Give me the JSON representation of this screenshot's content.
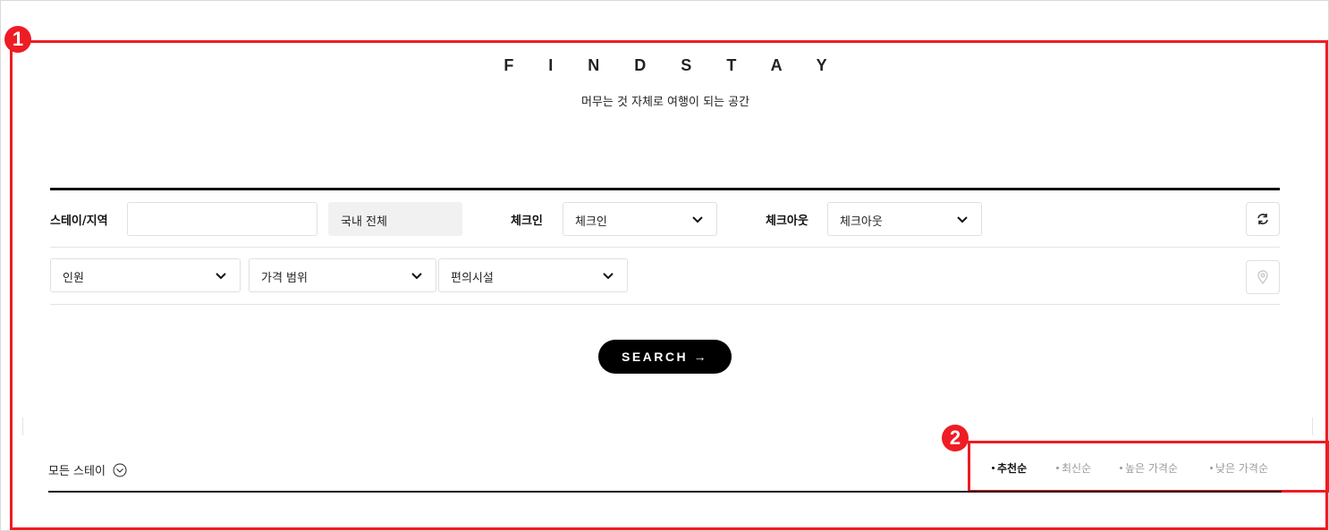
{
  "header": {
    "title": "F I N D  S T A Y",
    "subtitle": "머무는 것 자체로 여행이 되는 공간"
  },
  "search_form": {
    "stay_region_label": "스테이/지역",
    "stay_region_value": "",
    "region_select_value": "국내 전체",
    "checkin_label": "체크인",
    "checkin_value": "체크인",
    "checkout_label": "체크아웃",
    "checkout_value": "체크아웃",
    "guests_value": "인원",
    "price_value": "가격 범위",
    "facilities_value": "편의시설",
    "search_button": "SEARCH →"
  },
  "listing": {
    "all_stays_label": "모든 스테이",
    "sort_options": [
      "추천순",
      "최신순",
      "높은 가격순",
      "낮은 가격순"
    ],
    "active_sort": "추천순"
  },
  "annotations": [
    "1",
    "2"
  ],
  "colors": {
    "annotation_red": "#ee1c24",
    "primary_black": "#000000",
    "muted_grey": "#9a9a9a"
  }
}
